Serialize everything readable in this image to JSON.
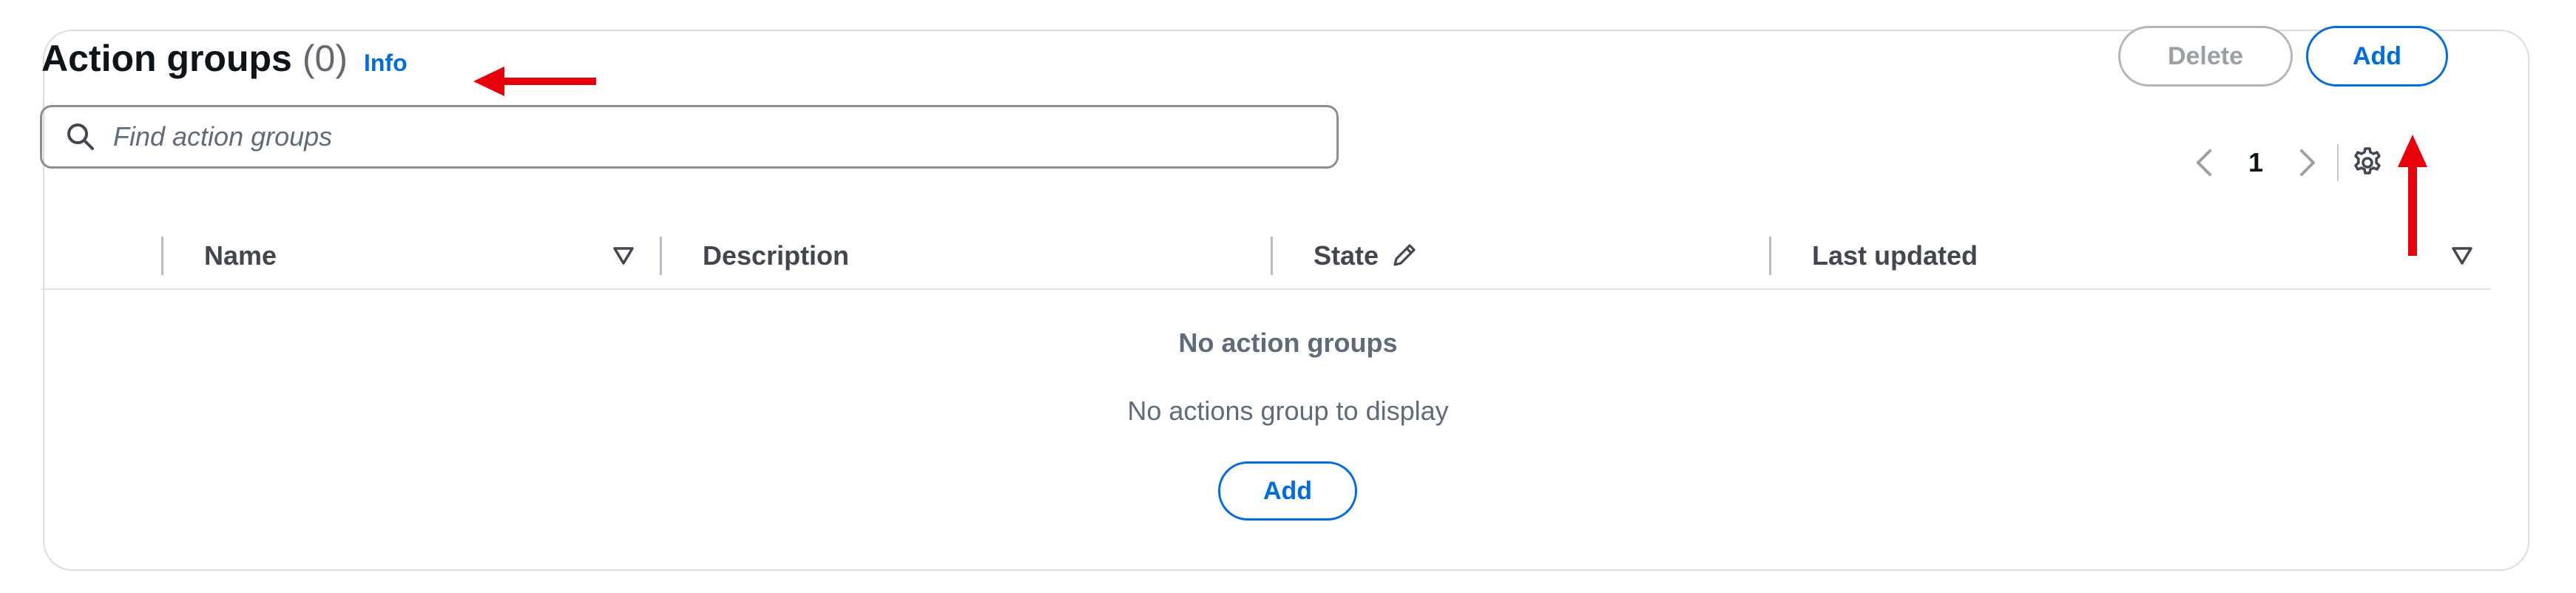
{
  "header": {
    "title": "Action groups",
    "count": "(0)",
    "info_label": "Info"
  },
  "actions": {
    "delete_label": "Delete",
    "add_label": "Add"
  },
  "search": {
    "placeholder": "Find action groups"
  },
  "pagination": {
    "current_page": "1"
  },
  "table": {
    "columns": [
      {
        "label": "Name",
        "sortable": true
      },
      {
        "label": "Description"
      },
      {
        "label": "State",
        "editable": true
      },
      {
        "label": "Last updated",
        "sortable": true
      }
    ]
  },
  "empty_state": {
    "title": "No action groups",
    "description": "No actions group to display",
    "add_label": "Add"
  },
  "annotations": {
    "color": "#e8000b"
  },
  "colors": {
    "accent": "#006ce0",
    "disabled": "#9ba0a8"
  }
}
